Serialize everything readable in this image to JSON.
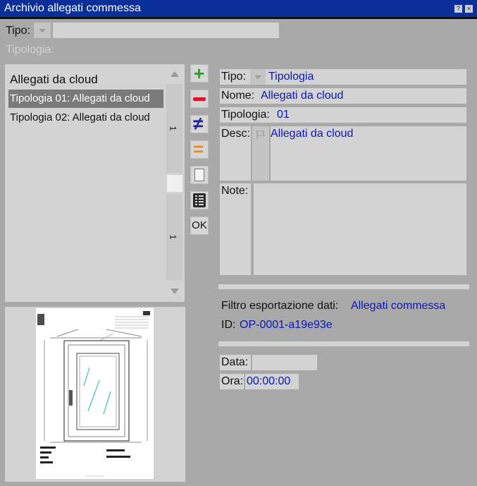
{
  "window": {
    "title": "Archivio allegati commessa",
    "help_glyph": "?",
    "close_glyph": "×"
  },
  "filter": {
    "tipo_label": "Tipo:",
    "tipo_value": "",
    "tipologia_label": "Tipologia:"
  },
  "list": {
    "header": "Allegati da cloud",
    "items": [
      {
        "label": "Tipologia 01: Allegati da cloud",
        "selected": true
      },
      {
        "label": "Tipologia 02: Allegati da cloud",
        "selected": false
      }
    ],
    "scroll_marker_top": "1",
    "scroll_marker_bottom": "1"
  },
  "toolbar": {
    "add_glyph": "+",
    "remove_glyph": "−",
    "diff_glyph": "≠",
    "equal_glyph": "=",
    "ok_label": "OK"
  },
  "detail": {
    "tipo_label": "Tipo:",
    "tipo_value": "Tipologia",
    "nome_label": "Nome:",
    "nome_value": "Allegati da cloud",
    "tipologia_label": "Tipologia:",
    "tipologia_value": "01",
    "desc_label": "Desc:",
    "desc_value": "Allegati da cloud",
    "note_label": "Note:",
    "note_value": "",
    "filtro_label": "Filtro esportazione dati:",
    "filtro_value": "Allegati commessa",
    "id_label": "ID:",
    "id_value": "OP-0001-a19e93e",
    "data_label": "Data:",
    "data_value": "",
    "ora_label": "Ora:",
    "ora_value": "00:00:00"
  },
  "colors": {
    "titlebar": "#0a2f98",
    "value_text": "#0c16b4",
    "panel": "#d3d3d3",
    "background": "#a9a9a9",
    "selection": "#7a7a7a"
  }
}
